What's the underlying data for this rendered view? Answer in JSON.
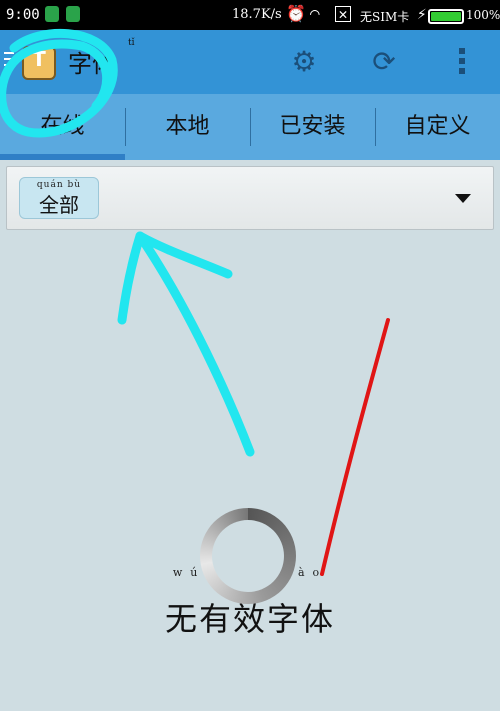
{
  "status_bar": {
    "time": "9:00",
    "net_speed": "18.7K/s",
    "sim_text": "无SIM卡",
    "battery_percent": "100%",
    "battery_level": 1.0,
    "icons": [
      "shield-icon",
      "sim-icon",
      "alarm-icon",
      "wifi-icon",
      "no-sim-icon",
      "charging-icon",
      "battery-icon"
    ]
  },
  "app_bar": {
    "title": "字体",
    "title_pinyin": "tǐ",
    "logo_letter": "T",
    "actions": [
      "settings-icon",
      "refresh-icon",
      "more-icon"
    ]
  },
  "tabs": [
    {
      "label": "在线",
      "active": true
    },
    {
      "label": "本地",
      "active": false
    },
    {
      "label": "已安装",
      "active": false
    },
    {
      "label": "自定义",
      "active": false
    }
  ],
  "filter": {
    "selected_pinyin": "quán  bù",
    "selected": "全部"
  },
  "empty_state": {
    "pinyin": "wú yǒu xiào zì tǐ",
    "message": "无有效字体"
  },
  "colors": {
    "app_bar": "#3393d6",
    "tabs": "#5aa9df",
    "background": "#cfdde2",
    "annotation_cyan": "#22e6ef",
    "annotation_red": "#e01515"
  }
}
